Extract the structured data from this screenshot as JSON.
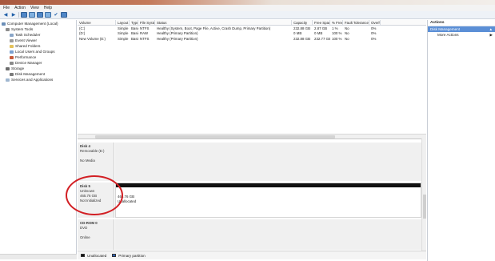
{
  "menu": [
    "File",
    "Action",
    "View",
    "Help"
  ],
  "toolbar": {
    "icons": [
      "back-arrow-icon",
      "forward-arrow-icon",
      "up-folder-icon",
      "properties-icon",
      "help-icon",
      "show-hide-icon",
      "check-icon",
      "settings-icon"
    ]
  },
  "tree": {
    "items": [
      {
        "label": "Computer Management (Local)",
        "indent": 0,
        "icon": "computer-icon",
        "color": "#6b8fb8"
      },
      {
        "label": "System Tools",
        "indent": 1,
        "icon": "tools-icon",
        "color": "#8d8d8d"
      },
      {
        "label": "Task Scheduler",
        "indent": 2,
        "icon": "clock-icon",
        "color": "#8aa6c8"
      },
      {
        "label": "Event Viewer",
        "indent": 2,
        "icon": "event-icon",
        "color": "#9b9b9b"
      },
      {
        "label": "Shared Folders",
        "indent": 2,
        "icon": "folder-icon",
        "color": "#e4c25a"
      },
      {
        "label": "Local Users and Groups",
        "indent": 2,
        "icon": "users-icon",
        "color": "#7aa0d0"
      },
      {
        "label": "Performance",
        "indent": 2,
        "icon": "chart-icon",
        "color": "#c75a3a"
      },
      {
        "label": "Device Manager",
        "indent": 2,
        "icon": "device-icon",
        "color": "#8a8a8a"
      },
      {
        "label": "Storage",
        "indent": 1,
        "icon": "storage-icon",
        "color": "#6d6d6d"
      },
      {
        "label": "Disk Management",
        "indent": 2,
        "icon": "disk-icon",
        "color": "#7b7b7b"
      },
      {
        "label": "Services and Applications",
        "indent": 1,
        "icon": "services-icon",
        "color": "#a0b7d0"
      }
    ]
  },
  "volumes": {
    "headers": [
      "Volume",
      "Layout",
      "Type",
      "File System",
      "Status",
      "Capacity",
      "Free Space",
      "% Free",
      "Fault Tolerance",
      "Overh"
    ],
    "rows": [
      [
        "(C:)",
        "Simple",
        "Basic",
        "NTFS",
        "Healthy (System, Boot, Page File, Active, Crash Dump, Primary Partition)",
        "232.88 GB",
        "2.87 GB",
        "1 %",
        "No",
        "0%"
      ],
      [
        "(D:)",
        "Simple",
        "Basic",
        "RAW",
        "Healthy (Primary Partition)",
        "0 MB",
        "0 MB",
        "100 %",
        "No",
        "0%"
      ],
      [
        "New Volume (E:)",
        "Simple",
        "Basic",
        "NTFS",
        "Healthy (Primary Partition)",
        "232.88 GB",
        "232.77 GB",
        "100 %",
        "No",
        "0%"
      ]
    ]
  },
  "disks": [
    {
      "name": "Disk 4",
      "lines": [
        "Removable (E:)",
        "",
        "No Media"
      ],
      "bar": false,
      "part": []
    },
    {
      "name": "Disk 5",
      "lines": [
        "Unknown",
        "465.76 GB",
        "Not Initialized"
      ],
      "bar": true,
      "part": [
        "465.76 GB",
        "Unallocated"
      ]
    },
    {
      "name": "CD-ROM 0",
      "lines": [
        "DVD",
        "",
        "Online"
      ],
      "bar": false,
      "part": []
    }
  ],
  "legend": {
    "unallocated": "Unallocated",
    "primary": "Primary partition"
  },
  "actions": {
    "header": "Actions",
    "selected": "Disk Management",
    "more": "More Actions"
  }
}
